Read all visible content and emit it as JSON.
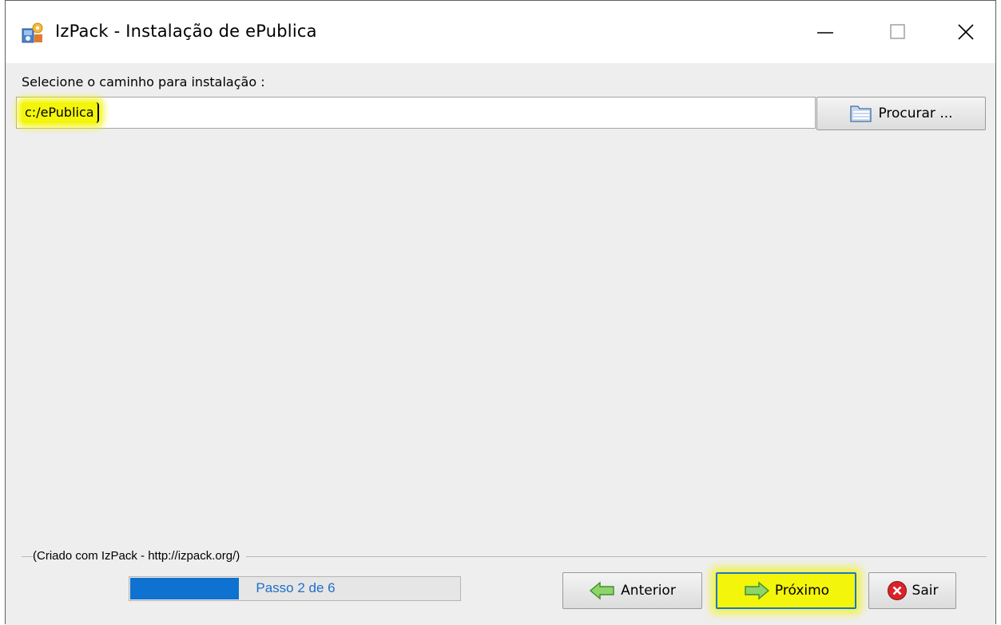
{
  "window": {
    "title": "IzPack - Instalação de  ePublica",
    "controls": [
      "minimize",
      "maximize",
      "close"
    ]
  },
  "install_path": {
    "label": "Selecione o caminho para instalação :",
    "value": "c:/ePublica",
    "browse_label": "Procurar ..."
  },
  "footer": {
    "credit": "(Criado com IzPack - http://izpack.org/)",
    "progress": {
      "text": "Passo 2 de 6",
      "fraction": 0.333
    }
  },
  "buttons": {
    "back": "Anterior",
    "next": "Próximo",
    "quit": "Sair"
  },
  "icons": {
    "app": "izpack-app-icon",
    "browse": "folder-icon",
    "back": "arrow-left-icon",
    "next": "arrow-right-icon",
    "quit": "red-x-icon"
  },
  "colors": {
    "highlight": "#f3f50a",
    "progress": "#0f71d0",
    "arrow_green": "#6cc24a",
    "quit_red": "#d8232a"
  }
}
